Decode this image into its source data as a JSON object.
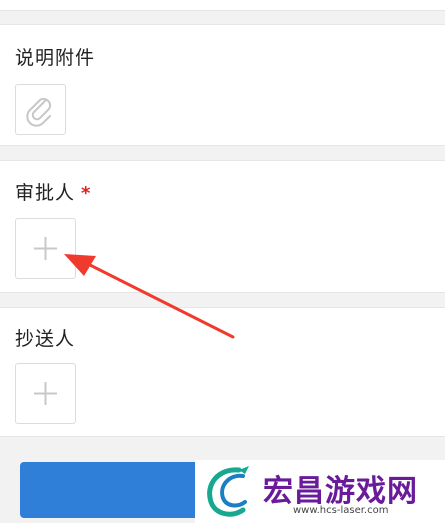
{
  "sections": {
    "attachment": {
      "label": "说明附件",
      "icon": "paperclip-icon"
    },
    "approver": {
      "label": "审批人",
      "required_mark": "*",
      "icon": "plus-icon"
    },
    "cc": {
      "label": "抄送人",
      "icon": "plus-icon"
    }
  },
  "watermark": {
    "title": "宏昌游戏网",
    "url": "www.hcs-laser.com"
  },
  "colors": {
    "primary_button": "#2f7ed8",
    "required": "#e02020",
    "arrow": "#f03a2e"
  }
}
